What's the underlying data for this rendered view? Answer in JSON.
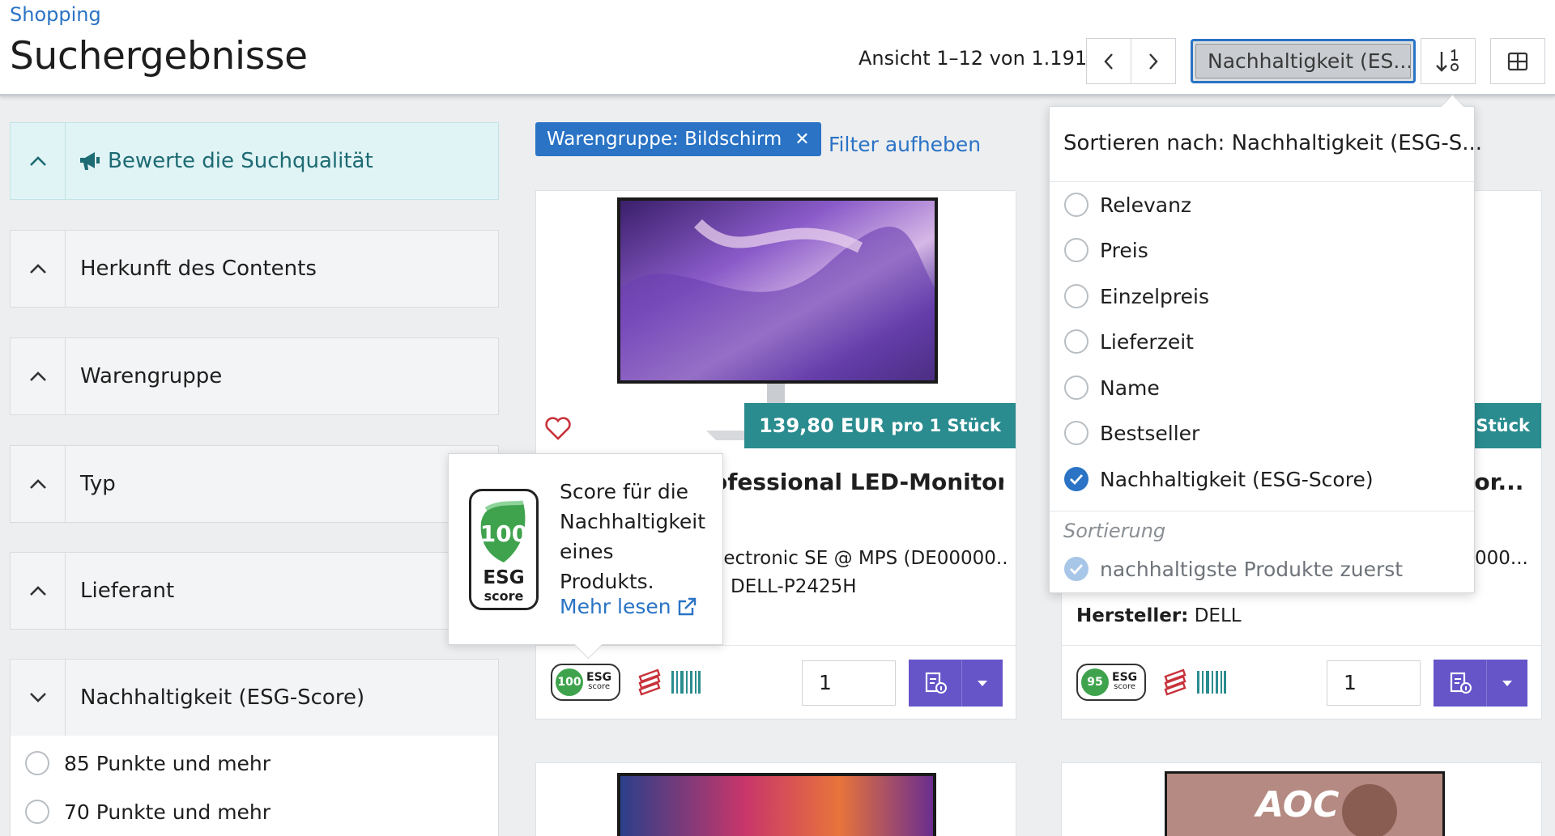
{
  "header": {
    "breadcrumb": "Shopping",
    "title": "Suchergebnisse",
    "pager_text": "Ansicht 1–12 von 1.191",
    "sort_value": "Nachhaltigkeit (ES..."
  },
  "sidebar": {
    "search_quality": "Bewerte die Suchqualität",
    "facets": [
      "Herkunft des Contents",
      "Warengruppe",
      "Typ",
      "Lieferant",
      "Nachhaltigkeit (ESG-Score)"
    ],
    "esg_options": [
      "85 Punkte und mehr",
      "70 Punkte und mehr"
    ]
  },
  "filter": {
    "chip_label": "Warengruppe: Bildschirm",
    "chip_close": "✕",
    "clear_label": "Filter aufheben"
  },
  "products": [
    {
      "price": "139,80 EUR",
      "unit": "pro 1 Stück",
      "title": "ofessional LED-Monitor...",
      "meta1": "lectronic SE @ MPS (DE00000...",
      "meta2": ": DELL-P2425H",
      "esg_score": "100",
      "esg_label": "ESG",
      "esg_sub": "score",
      "qty": "1"
    },
    {
      "price_partial": "Stück",
      "title": "tor...",
      "meta1": "000...",
      "manufacturer_label": "Hersteller:",
      "manufacturer": "DELL",
      "esg_score": "95",
      "esg_label": "ESG",
      "esg_sub": "score",
      "qty": "1"
    }
  ],
  "bottom_cards": [
    {},
    {
      "brand": "AOC"
    }
  ],
  "tooltip": {
    "text": "Score für die Nachhaltigkeit eines Produkts.",
    "link": "Mehr lesen",
    "score": "100",
    "esg": "ESG",
    "score_word": "score"
  },
  "sort_panel": {
    "heading": "Sortieren nach: Nachhaltigkeit (ESG-S...",
    "options": [
      "Relevanz",
      "Preis",
      "Einzelpreis",
      "Lieferzeit",
      "Name",
      "Bestseller",
      "Nachhaltigkeit (ESG-Score)"
    ],
    "selected_index": 6,
    "order_section": "Sortierung",
    "order_value": "nachhaltigste Produkte zuerst"
  },
  "colors": {
    "accent": "#2a73c5",
    "price_banner": "#2a8c8f",
    "cart_button": "#6555c8",
    "esg_green": "#3fa34d"
  }
}
